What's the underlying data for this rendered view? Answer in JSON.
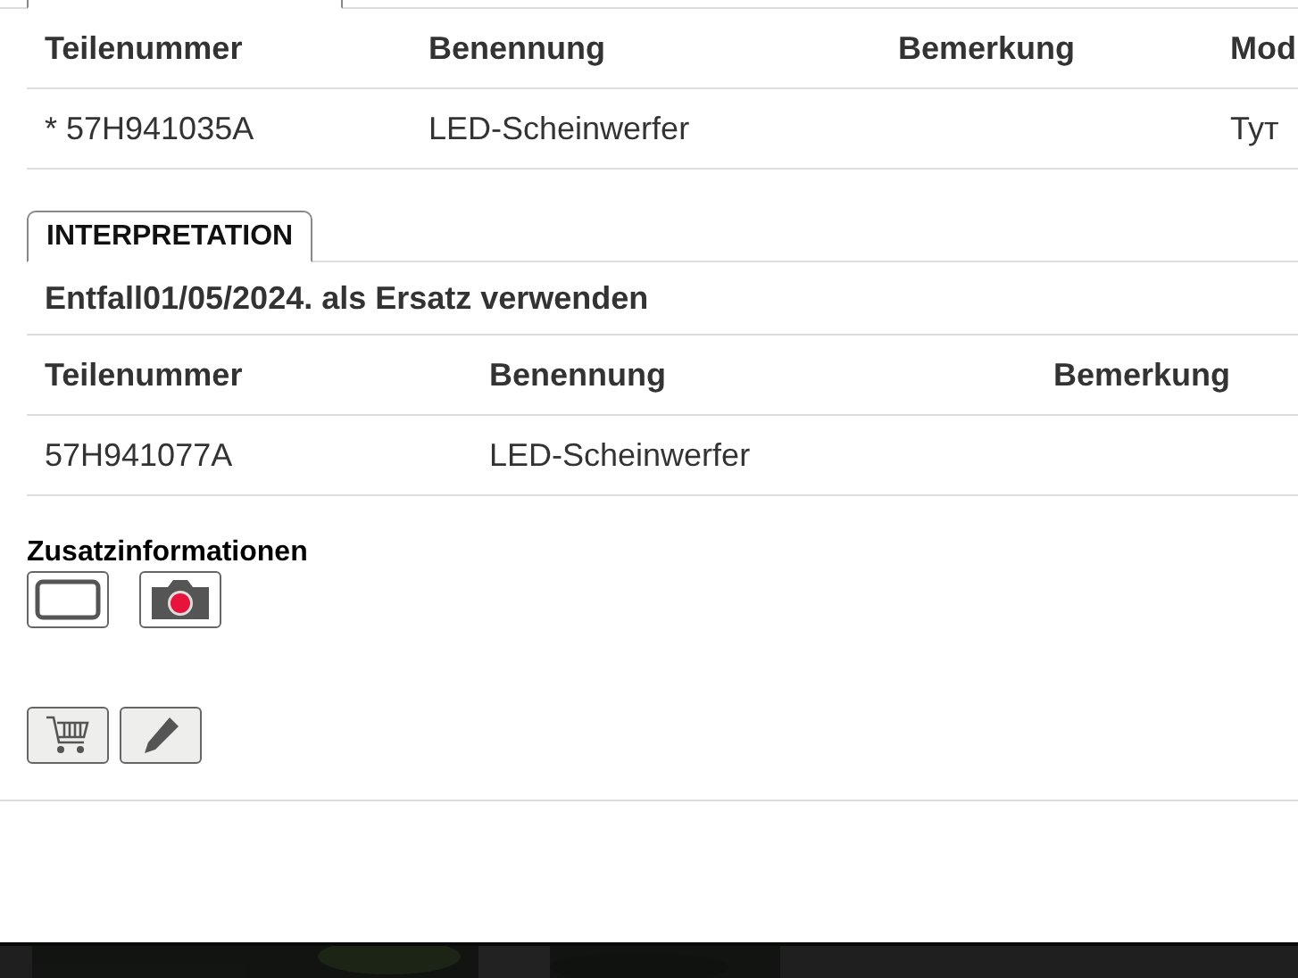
{
  "parts_table": {
    "columns": [
      "Teilenummer",
      "Benennung",
      "Bemerkung",
      "Mod"
    ],
    "rows": [
      {
        "cells": [
          "* 57H941035A",
          "LED-Scheinwerfer",
          null,
          "Тут"
        ]
      }
    ]
  },
  "interpretation": {
    "tab": {
      "label": "INTERPRETATION",
      "selected": true
    },
    "note": "Entfall01/05/2024. als Ersatz verwenden",
    "columns": [
      "Teilenummer",
      "Benennung",
      "Bemerkung"
    ],
    "rows": [
      {
        "cells": [
          "57H941077A",
          "LED-Scheinwerfer",
          null
        ]
      }
    ]
  },
  "additional_info": {
    "title": "Zusatzinformationen",
    "items": [
      {
        "kind": "frame"
      },
      {
        "kind": "camera"
      }
    ]
  },
  "actions": [
    {
      "kind": "cart"
    },
    {
      "kind": "edit"
    }
  ]
}
